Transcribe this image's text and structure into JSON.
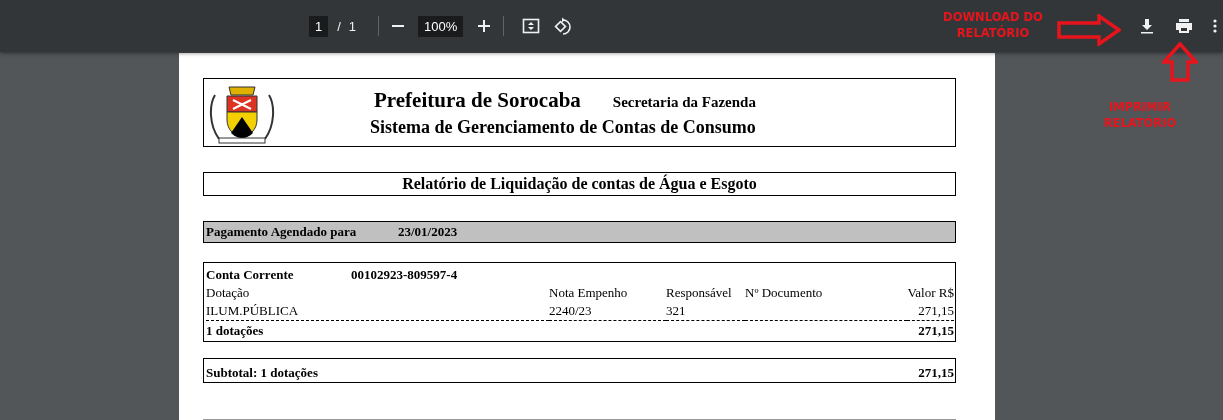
{
  "toolbar": {
    "page_number": "1",
    "page_separator": "/",
    "page_count": "1",
    "zoom": "100%"
  },
  "annotations": [
    {
      "kind": "arrow-right",
      "text": "DOWNLOAD DO RELATÓRIO"
    },
    {
      "kind": "arrow-up",
      "text": "IMPRIMIR RELATÓRIO"
    }
  ],
  "document": {
    "header": {
      "title": "Prefeitura de Sorocaba",
      "department": "Secretaria da Fazenda",
      "system": "Sistema de Gerenciamento de Contas de Consumo"
    },
    "report_title": "Relatório de Liquidação de contas de Água e Esgoto",
    "payment": {
      "label": "Pagamento Agendado para",
      "date": "23/01/2023"
    },
    "account": {
      "label": "Conta Corrente",
      "number": "00102923-809597-4",
      "columns": [
        "Dotação",
        "Nota Empenho",
        "Responsável",
        "Nº Documento",
        "Valor R$"
      ],
      "rows": [
        [
          "ILUM.PÚBLICA",
          "2240/23",
          "321",
          "",
          "271,15"
        ]
      ],
      "total_label": "1 dotações",
      "total_value": "271,15"
    },
    "subtotal": {
      "label": "Subtotal: 1 dotações",
      "value": "271,15"
    }
  }
}
